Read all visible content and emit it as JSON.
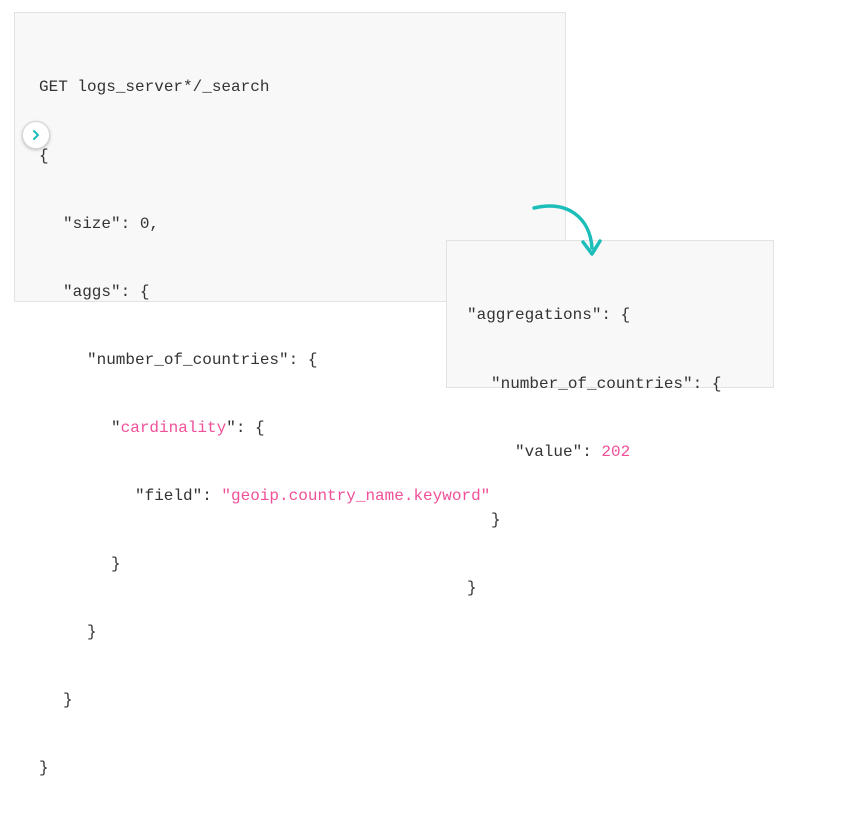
{
  "request": {
    "endpoint": "GET logs_server*/_search",
    "open_brace": "{",
    "size_key": "\"size\": 0,",
    "aggs_key": "\"aggs\": {",
    "agg_name": "\"number_of_countries\": {",
    "cardinality_quote_open": "\"",
    "cardinality_word": "cardinality",
    "cardinality_rest": "\": {",
    "field_key": "\"field\": ",
    "field_value": "\"geoip.country_name.keyword\"",
    "close_brace": "}"
  },
  "response": {
    "aggregations_key": "\"aggregations\": {",
    "agg_name": "\"number_of_countries\": {",
    "value_key": "\"value\": ",
    "value": "202",
    "close_brace": "}"
  },
  "icons": {
    "run": "chevron-right-icon",
    "result_arrow": "curved-arrow-icon"
  },
  "colors": {
    "accent_teal": "#1bbeb8",
    "highlight_pink": "#ef5098",
    "panel_bg": "#f8f8f8"
  }
}
